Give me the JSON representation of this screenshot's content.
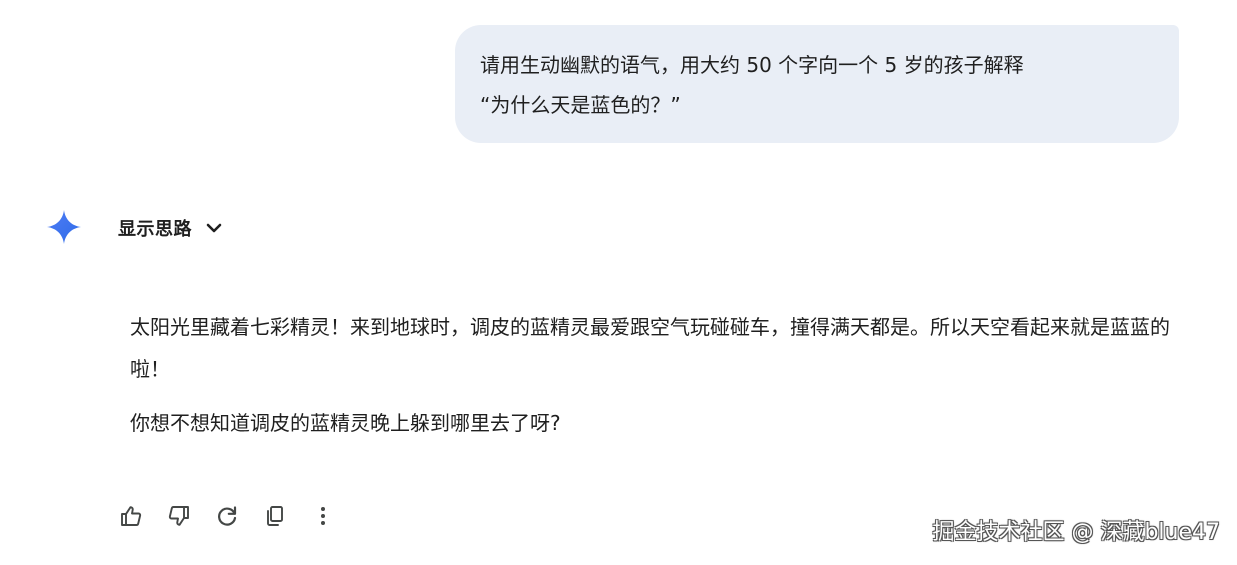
{
  "user_message": {
    "lines": [
      "请用生动幽默的语气，用大约 50 个字向一个 5 岁的孩子解释",
      "“为什么天是蓝色的？”"
    ]
  },
  "thinking": {
    "label": "显示思路",
    "icon": "chevron-down-icon"
  },
  "assistant_icon": "gemini-sparkle-icon",
  "colors": {
    "user_bubble": "#e9eef6",
    "sparkle_blue": "#4285f4",
    "text": "#1f1f1f",
    "icon": "#444746"
  },
  "response": {
    "paragraphs": [
      "太阳光里藏着七彩精灵！来到地球时，调皮的蓝精灵最爱跟空气玩碰碰车，撞得满天都是。所以天空看起来就是蓝蓝的啦！",
      "你想不想知道调皮的蓝精灵晚上躲到哪里去了呀?"
    ]
  },
  "actions": [
    {
      "icon": "thumbs-up-icon"
    },
    {
      "icon": "thumbs-down-icon"
    },
    {
      "icon": "regenerate-icon"
    },
    {
      "icon": "copy-icon"
    },
    {
      "icon": "more-vert-icon"
    }
  ],
  "watermark": "掘金技术社区 @ 深藏blue47"
}
